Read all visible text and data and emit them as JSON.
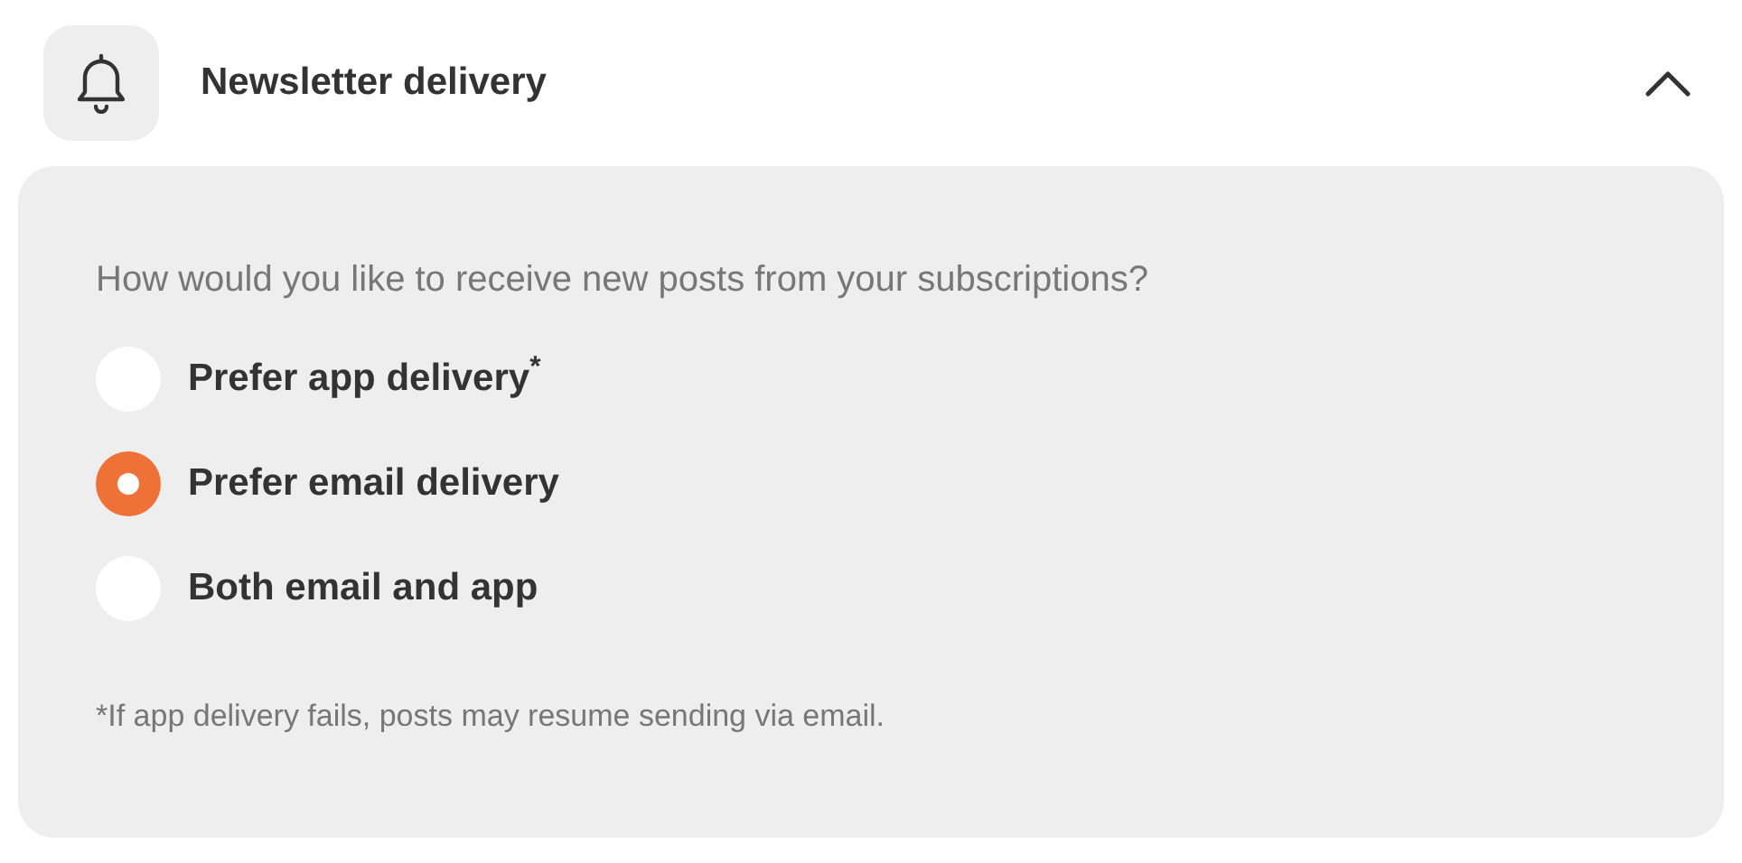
{
  "section": {
    "title": "Newsletter delivery",
    "expanded": true
  },
  "question": "How would you like to receive new posts from your subscriptions?",
  "options": [
    {
      "label": "Prefer app delivery$^{*}$",
      "selected": false
    },
    {
      "label": "Prefer email delivery",
      "selected": true
    },
    {
      "label": "Both email and app",
      "selected": false
    }
  ],
  "footnote": "*If app delivery fails, posts may resume sending via email."
}
